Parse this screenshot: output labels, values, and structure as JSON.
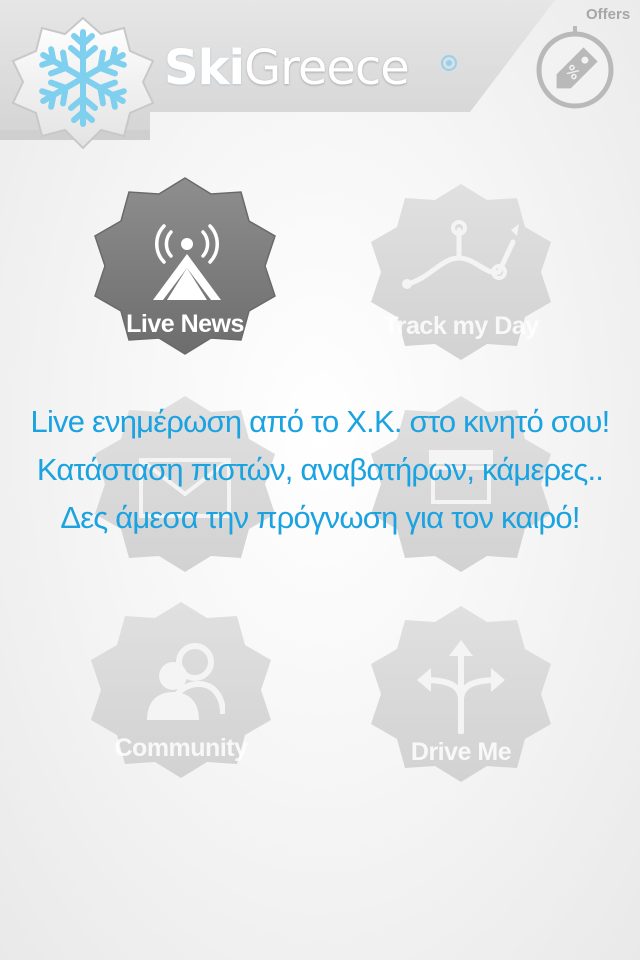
{
  "header": {
    "brand_ski": "Ski",
    "brand_greece": "Greece",
    "offers_label": "Offers"
  },
  "menu": {
    "live_news": "Live News",
    "track_my_day": "Track my Day",
    "community": "Community",
    "drive_me": "Drive Me"
  },
  "promo": {
    "line1": "Live ενημέρωση από το Χ.Κ. στο κινητό σου!",
    "line2": "Κατάσταση πιστών, αναβατήρων, κάμερες..",
    "line3": "Δες άμεσα την πρόγνωση για τον καιρό!"
  },
  "colors": {
    "accent_blue": "#1aa3e0",
    "active_tile": "#7a7a7a",
    "inactive_tile": "#d8d8d8",
    "snowflake": "#7fd0ee"
  },
  "icons": {
    "logo": "snowflake-icon",
    "offers": "price-tag-icon",
    "live_news": "broadcast-tower-icon",
    "track_my_day": "route-icon",
    "community": "users-icon",
    "drive_me": "directions-arrows-icon"
  }
}
